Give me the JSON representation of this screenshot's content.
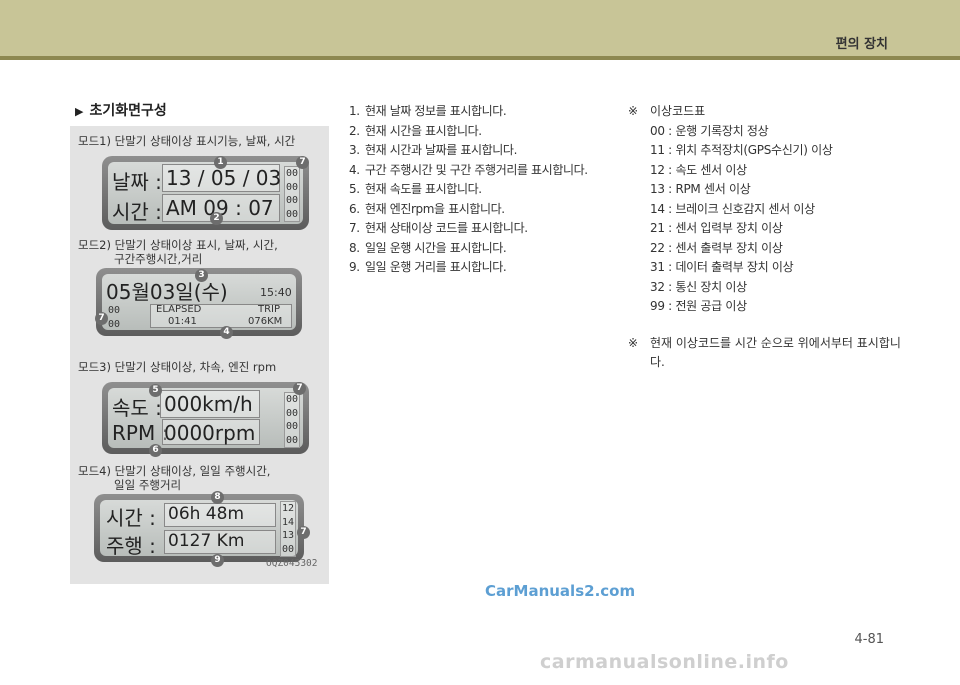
{
  "header": {
    "title": "편의 장치"
  },
  "section": {
    "heading": "초기화면구성"
  },
  "modes": [
    {
      "label": "모드1) 단말기 상태이상 표시기능, 날짜, 시간",
      "line1_key": "날짜 :",
      "line1_val": "13 / 05 / 03",
      "line2_key": "시간 :",
      "line2_val": "AM  09 : 07",
      "codes": [
        "00",
        "00",
        "00",
        "00"
      ],
      "badges": [
        "1",
        "2",
        "7"
      ]
    },
    {
      "label_line1": "모드2) 단말기 상태이상 표시, 날짜, 시간,",
      "label_line2": "구간주행시간,거리",
      "date": "05월03일(수)",
      "time": "15:40",
      "elapsed_label": "ELAPSED",
      "elapsed_val": "01:41",
      "trip_label": "TRIP",
      "trip_val": "076KM",
      "codes": [
        "00",
        "00"
      ],
      "badges": [
        "3",
        "4",
        "7"
      ]
    },
    {
      "label": "모드3) 단말기 상태이상, 차속, 엔진 rpm",
      "line1_key": "속도 :",
      "line1_val": "000km/h",
      "line2_key": "RPM :",
      "line2_val": "0000rpm",
      "codes": [
        "00",
        "00",
        "00",
        "00"
      ],
      "badges": [
        "5",
        "6",
        "7"
      ]
    },
    {
      "label_line1": "모드4) 단말기 상태이상, 일일 주행시간,",
      "label_line2": "일일 주행거리",
      "line1_key": "시간 :",
      "line1_val": "06h 48m",
      "line2_key": "주행 :",
      "line2_val": "0127 Km",
      "codes": [
        "12",
        "14",
        "13",
        "00"
      ],
      "badges": [
        "8",
        "9",
        "7"
      ]
    }
  ],
  "image_code": "OQZ045302",
  "items": [
    {
      "num": "1.",
      "text": "현재 날짜 정보를 표시합니다."
    },
    {
      "num": "2.",
      "text": "현재 시간을 표시합니다."
    },
    {
      "num": "3.",
      "text": "현재 시간과 날짜를 표시합니다."
    },
    {
      "num": "4.",
      "text": "구간 주행시간 및 구간 주행거리를 표시합니다."
    },
    {
      "num": "5.",
      "text": "현재 속도를 표시합니다."
    },
    {
      "num": "6.",
      "text": "현재 엔진rpm을 표시합니다."
    },
    {
      "num": "7.",
      "text": "현재 상태이상 코드를 표시합니다."
    },
    {
      "num": "8.",
      "text": "일일 운행 시간을 표시합니다."
    },
    {
      "num": "9.",
      "text": "일일 운행 거리를 표시합니다."
    }
  ],
  "error_codes": {
    "ref": "※",
    "title": "이상코드표",
    "rows": [
      "00 : 운행 기록장치 정상",
      "11 : 위치 추적장치(GPS수신기) 이상",
      "12 :  속도 센서 이상",
      "13 : RPM 센서 이상",
      "14 : 브레이크 신호감지 센서 이상",
      "21 : 센서 입력부 장치 이상",
      "22 : 센서 출력부 장치 이상",
      "31 : 데이터 출력부 장치 이상",
      "32 : 통신 장치 이상",
      "99 : 전원 공급 이상"
    ],
    "note_ref": "※",
    "note": "현재 이상코드를 시간 순으로 위에서부터 표시합니다."
  },
  "watermark": "CarManuals2.com",
  "page_number": "4-81",
  "footer_watermark": "carmanualsonline.info"
}
